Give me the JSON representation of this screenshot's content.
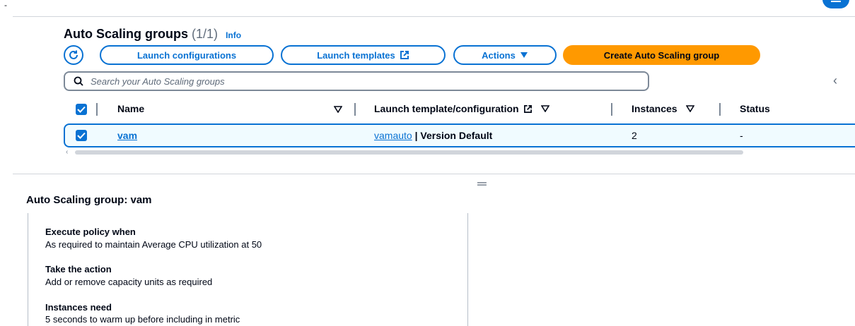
{
  "top": {
    "dash": "-"
  },
  "header": {
    "title": "Auto Scaling groups",
    "count": "(1/1)",
    "info": "Info"
  },
  "toolbar": {
    "launch_configurations": "Launch configurations",
    "launch_templates": "Launch templates",
    "actions": "Actions",
    "create": "Create Auto Scaling group"
  },
  "search": {
    "placeholder": "Search your Auto Scaling groups"
  },
  "table": {
    "columns": [
      "Name",
      "Launch template/configuration",
      "Instances",
      "Status"
    ],
    "rows": [
      {
        "name": "vam",
        "template_link": "vamauto",
        "template_rest": " | Version Default",
        "instances": "2",
        "status": "-"
      }
    ]
  },
  "detail": {
    "title": "Auto Scaling group: vam",
    "items": [
      {
        "label": "Execute policy when",
        "value": "As required to maintain Average CPU utilization at 50"
      },
      {
        "label": "Take the action",
        "value": "Add or remove capacity units as required"
      },
      {
        "label": "Instances need",
        "value": "5 seconds to warm up before including in metric"
      }
    ]
  },
  "colors": {
    "accent": "#0972d3",
    "primary": "#ff9900"
  }
}
